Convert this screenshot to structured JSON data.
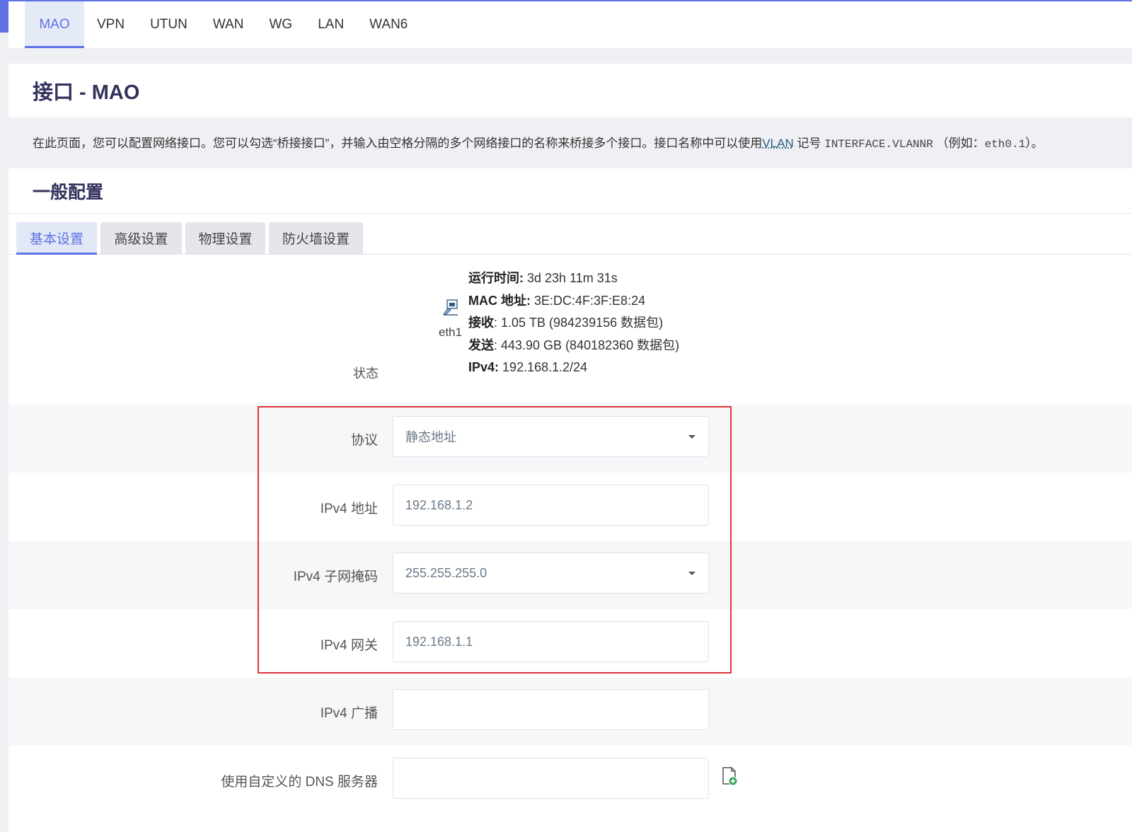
{
  "interface_tabs": [
    "MAO",
    "VPN",
    "UTUN",
    "WAN",
    "WG",
    "LAN",
    "WAN6"
  ],
  "page_title": "接口 - MAO",
  "description": {
    "text_before": "在此页面，您可以配置网络接口。您可以勾选“桥接接口”，并输入由空格分隔的多个网络接口的名称来桥接多个接口。接口名称中可以使用",
    "vlan": "VLAN",
    "text_mid": "记号",
    "code1": "INTERFACE.VLANNR",
    "text_example": "（例如：",
    "code2": "eth0.1",
    "text_end": "）。"
  },
  "section_title": "一般配置",
  "sub_tabs": [
    "基本设置",
    "高级设置",
    "物理设置",
    "防火墙设置"
  ],
  "status": {
    "label": "状态",
    "device": "eth1",
    "uptime_label": "运行时间:",
    "uptime": "3d 23h 11m 31s",
    "mac_label": "MAC 地址:",
    "mac": "3E:DC:4F:3F:E8:24",
    "rx_label": "接收",
    "rx": ": 1.05 TB (984239156 数据包)",
    "tx_label": "发送",
    "tx": ": 443.90 GB (840182360 数据包)",
    "ipv4_label": "IPv4:",
    "ipv4": "192.168.1.2/24"
  },
  "fields": {
    "protocol": {
      "label": "协议",
      "value": "静态地址"
    },
    "ipv4_addr": {
      "label": "IPv4 地址",
      "value": "192.168.1.2"
    },
    "ipv4_mask": {
      "label": "IPv4 子网掩码",
      "value": "255.255.255.0"
    },
    "ipv4_gw": {
      "label": "IPv4 网关",
      "value": "192.168.1.1"
    },
    "ipv4_bcast": {
      "label": "IPv4 广播",
      "value": ""
    },
    "dns": {
      "label": "使用自定义的 DNS 服务器",
      "value": ""
    }
  },
  "colors": {
    "accent": "#5e72e4",
    "highlight": "#e0343a"
  }
}
